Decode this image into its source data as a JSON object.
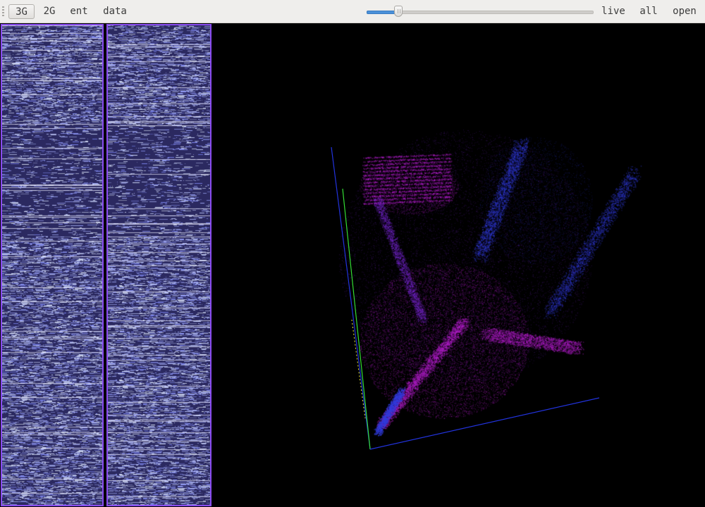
{
  "toolbar": {
    "buttons": [
      {
        "label": "3G",
        "active": true
      },
      {
        "label": "2G",
        "active": false
      },
      {
        "label": "ent",
        "active": false
      },
      {
        "label": "data",
        "active": false
      }
    ],
    "slider_value": 0.14,
    "right_buttons": [
      {
        "label": "live"
      },
      {
        "label": "all"
      },
      {
        "label": "open"
      }
    ]
  },
  "colors": {
    "panel_border": "#8a4cf0",
    "panel_bg": "#2b2960",
    "point_magenta": "#b01ec8",
    "point_blue": "#2a3ad6",
    "axis_green": "#33dd33",
    "axis_blue": "#2233dd",
    "axis_yellow": "#e8e83a"
  }
}
